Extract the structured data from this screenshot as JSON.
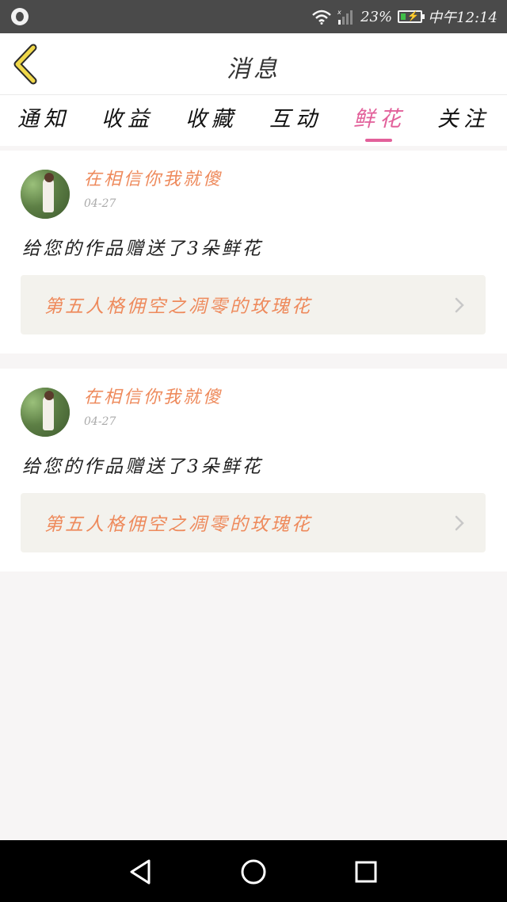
{
  "status_bar": {
    "battery_percent": "23%",
    "time": "中午12:14",
    "icons": [
      "app-notification-icon",
      "wifi-icon",
      "signal-icon",
      "battery-icon"
    ]
  },
  "header": {
    "title": "消息",
    "back_icon": "chevron-left-icon"
  },
  "tabs": [
    {
      "label": "通知",
      "active": false
    },
    {
      "label": "收益",
      "active": false
    },
    {
      "label": "收藏",
      "active": false
    },
    {
      "label": "互动",
      "active": false
    },
    {
      "label": "鲜花",
      "active": true
    },
    {
      "label": "关注",
      "active": false
    }
  ],
  "messages": [
    {
      "username": "在相信你我就傻",
      "date": "04-27",
      "text": "给您的作品赠送了3朵鲜花",
      "work_title": "第五人格佣空之凋零的玫瑰花"
    },
    {
      "username": "在相信你我就傻",
      "date": "04-27",
      "text": "给您的作品赠送了3朵鲜花",
      "work_title": "第五人格佣空之凋零的玫瑰花"
    }
  ],
  "colors": {
    "accent_pink": "#e2609a",
    "accent_orange": "#ee8a5c",
    "back_yellow": "#f0d84a"
  },
  "nav_bar": {
    "icons": [
      "back-triangle-icon",
      "home-circle-icon",
      "recents-square-icon"
    ]
  }
}
